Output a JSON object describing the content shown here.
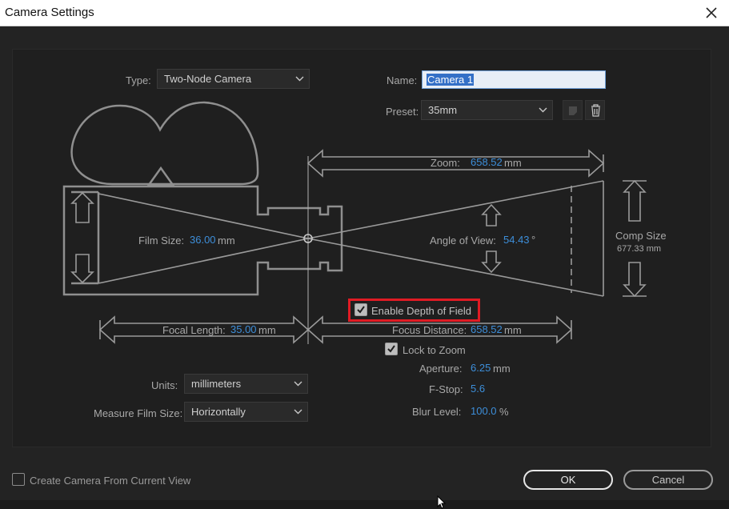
{
  "window": {
    "title": "Camera Settings"
  },
  "type": {
    "label": "Type:",
    "value": "Two-Node Camera"
  },
  "name": {
    "label": "Name:",
    "value": "Camera 1"
  },
  "preset": {
    "label": "Preset:",
    "value": "35mm"
  },
  "zoom": {
    "label": "Zoom:",
    "value": "658.52",
    "unit": "mm"
  },
  "film_size": {
    "label": "Film Size:",
    "value": "36.00",
    "unit": "mm"
  },
  "angle_of_view": {
    "label": "Angle of View:",
    "value": "54.43",
    "unit": "°"
  },
  "comp_size": {
    "label": "Comp Size",
    "value": "677.33 mm"
  },
  "enable_dof": {
    "label": "Enable Depth of Field",
    "checked": true
  },
  "focal_length": {
    "label": "Focal Length:",
    "value": "35.00",
    "unit": "mm"
  },
  "focus_distance": {
    "label": "Focus Distance:",
    "value": "658.52",
    "unit": "mm"
  },
  "lock_to_zoom": {
    "label": "Lock to Zoom",
    "checked": true
  },
  "aperture": {
    "label": "Aperture:",
    "value": "6.25",
    "unit": "mm"
  },
  "f_stop": {
    "label": "F-Stop:",
    "value": "5.6"
  },
  "blur_level": {
    "label": "Blur Level:",
    "value": "100.0",
    "unit": "%"
  },
  "units": {
    "label": "Units:",
    "value": "millimeters"
  },
  "measure_film_size": {
    "label": "Measure Film Size:",
    "value": "Horizontally"
  },
  "create_from_view": {
    "label": "Create Camera From Current View",
    "checked": false
  },
  "buttons": {
    "ok": "OK",
    "cancel": "Cancel"
  },
  "colors": {
    "value_blue": "#3d8ed9",
    "highlight_red": "#e01b24",
    "background": "#232323"
  }
}
